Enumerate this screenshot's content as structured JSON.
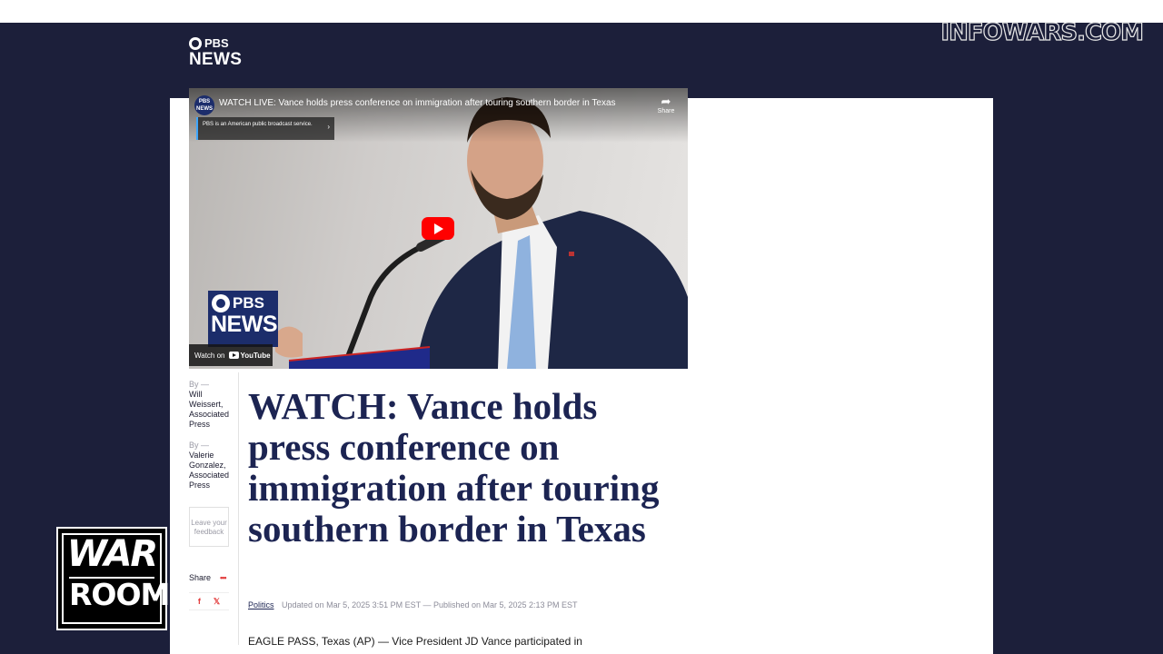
{
  "overlay": {
    "watermark": "INFOWARS.COM",
    "warroom_line1": "WAR",
    "warroom_line2": "ROOM"
  },
  "site": {
    "logo_line1": "PBS",
    "logo_line2": "NEWS"
  },
  "video": {
    "channel_icon": "PBS NEWS",
    "title": "WATCH LIVE: Vance holds press conference on immigration after touring southern border in Texas",
    "share_label": "Share",
    "info_text": "PBS is an American public broadcast service.",
    "logo_line1": "PBS",
    "logo_line2": "NEWS",
    "watch_on": "Watch on",
    "youtube_label": "YouTube"
  },
  "byline": {
    "by_label": "By —",
    "authors": [
      "Will Weissert, Associated Press",
      "Valerie Gonzalez, Associated Press"
    ],
    "feedback": "Leave your feedback",
    "share_label": "Share",
    "share_dots": "•••",
    "facebook": "f",
    "x": "𝕏"
  },
  "article": {
    "headline": "WATCH: Vance holds press conference on immigration after touring southern border in Texas",
    "category": "Politics",
    "dates": "Updated on Mar 5, 2025 3:51 PM EST — Published on Mar 5, 2025 2:13 PM EST",
    "lede": "EAGLE PASS, Texas (AP) — Vice President JD Vance participated in"
  },
  "colors": {
    "navy_bg": "#1c1f3a",
    "headline": "#1c2452",
    "play_button": "#ff0000",
    "pbs_blue": "#1c2d6b"
  }
}
